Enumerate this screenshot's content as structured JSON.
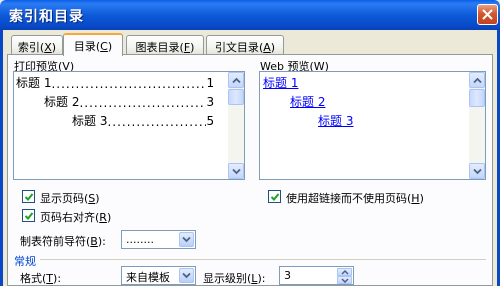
{
  "window": {
    "title": "索引和目录"
  },
  "tabs": [
    {
      "label": "索引",
      "key": "X"
    },
    {
      "label": "目录",
      "key": "C"
    },
    {
      "label": "图表目录",
      "key": "F"
    },
    {
      "label": "引文目录",
      "key": "A"
    }
  ],
  "print_preview": {
    "label": "打印预览",
    "key": "V",
    "entries": [
      {
        "text": "标题 1",
        "page": "1"
      },
      {
        "text": "标题 2",
        "page": "3"
      },
      {
        "text": "标题 3",
        "page": "5"
      }
    ]
  },
  "web_preview": {
    "label": "Web 预览",
    "key": "W",
    "links": [
      "标题 1",
      "标题 2",
      "标题 3"
    ]
  },
  "options": {
    "show_page_numbers": {
      "label": "显示页码",
      "key": "S",
      "checked": true
    },
    "right_align": {
      "label": "页码右对齐",
      "key": "R",
      "checked": true
    },
    "use_hyperlinks": {
      "label": "使用超链接而不使用页码",
      "key": "H",
      "checked": true
    },
    "tab_leader": {
      "label": "制表符前导符",
      "key": "B",
      "value": "........"
    }
  },
  "general": {
    "heading": "常规",
    "format": {
      "label": "格式",
      "key": "T",
      "value": "来自模板"
    },
    "levels": {
      "label": "显示级别",
      "key": "L",
      "value": "3"
    }
  },
  "colors": {
    "titlebar": "#0848c7",
    "accent_tab": "#f5a73a",
    "link": "#0000ff",
    "group_heading": "#0046d5"
  }
}
